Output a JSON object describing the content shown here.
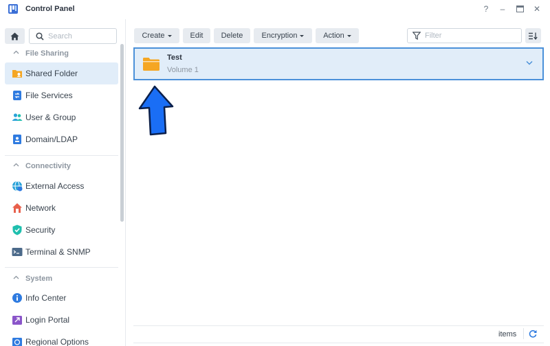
{
  "window": {
    "title": "Control Panel",
    "help_glyph": "?",
    "minimize_glyph": "–",
    "maximize_glyph": "▭",
    "close_glyph": "✕"
  },
  "search": {
    "placeholder": "Search"
  },
  "sidebar": {
    "sections": [
      {
        "label": "File Sharing",
        "items": [
          {
            "label": "Shared Folder",
            "icon": "shared-folder-icon",
            "active": true
          },
          {
            "label": "File Services",
            "icon": "file-services-icon"
          },
          {
            "label": "User & Group",
            "icon": "user-group-icon"
          },
          {
            "label": "Domain/LDAP",
            "icon": "domain-ldap-icon"
          }
        ]
      },
      {
        "label": "Connectivity",
        "items": [
          {
            "label": "External Access",
            "icon": "external-access-icon"
          },
          {
            "label": "Network",
            "icon": "network-icon"
          },
          {
            "label": "Security",
            "icon": "security-shield-icon"
          },
          {
            "label": "Terminal & SNMP",
            "icon": "terminal-icon"
          }
        ]
      },
      {
        "label": "System",
        "items": [
          {
            "label": "Info Center",
            "icon": "info-icon"
          },
          {
            "label": "Login Portal",
            "icon": "login-portal-icon"
          },
          {
            "label": "Regional Options",
            "icon": "regional-options-icon"
          }
        ]
      }
    ]
  },
  "toolbar": {
    "create_label": "Create",
    "edit_label": "Edit",
    "delete_label": "Delete",
    "encryption_label": "Encryption",
    "action_label": "Action",
    "filter_placeholder": "Filter"
  },
  "folders": [
    {
      "name": "Test",
      "volume": "Volume 1"
    }
  ],
  "footer": {
    "items_label": "items"
  },
  "colors": {
    "accent": "#4a90d9",
    "selected_bg": "#e1edf9",
    "folder": "#f5a623",
    "annotation_arrow": "#1a6ef5"
  }
}
